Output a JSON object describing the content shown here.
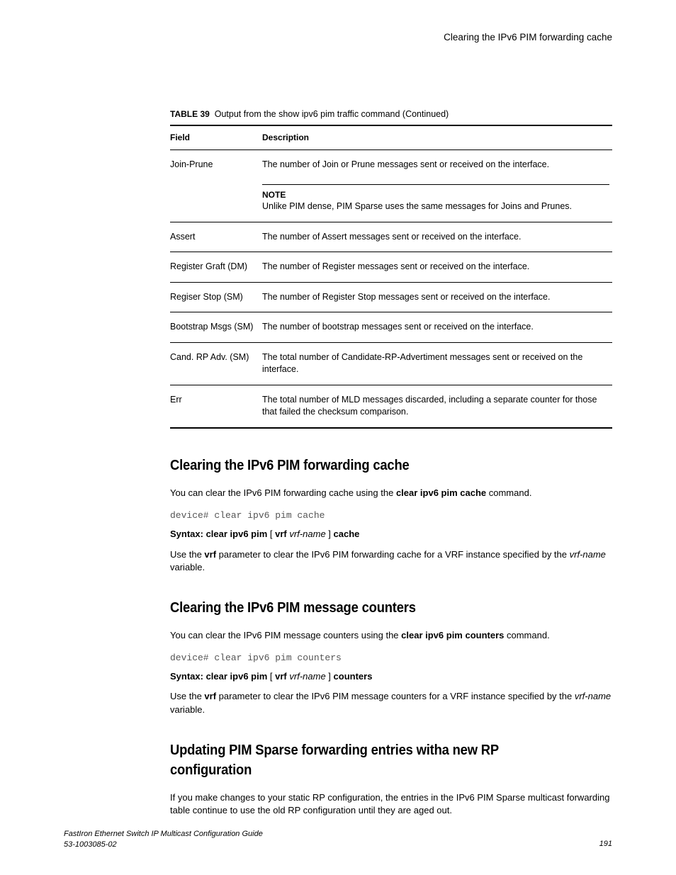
{
  "header": {
    "running_title": "Clearing the IPv6 PIM forwarding cache"
  },
  "table": {
    "caption_label": "TABLE 39",
    "caption_text": "Output from the show ipv6 pim traffic command (Continued)",
    "col_field": "Field",
    "col_desc": "Description",
    "rows": [
      {
        "field": "Join-Prune",
        "desc": "The number of Join or Prune messages sent or received on the interface.",
        "note_label": "NOTE",
        "note": "Unlike PIM dense, PIM Sparse uses the same messages for Joins and Prunes."
      },
      {
        "field": "Assert",
        "desc": "The number of Assert messages sent or received on the interface."
      },
      {
        "field": "Register Graft (DM)",
        "desc": "The number of Register messages sent or received on the interface."
      },
      {
        "field": "Regiser Stop (SM)",
        "desc": "The number of Register Stop messages sent or received on the interface."
      },
      {
        "field": "Bootstrap Msgs (SM)",
        "desc": "The number of bootstrap messages sent or received on the interface."
      },
      {
        "field": "Cand. RP Adv. (SM)",
        "desc": "The total number of Candidate-RP-Advertiment messages sent or received on the interface."
      },
      {
        "field": "Err",
        "desc": "The total number of MLD messages discarded, including a separate counter for those that failed the checksum comparison."
      }
    ]
  },
  "sections": {
    "s1": {
      "heading": "Clearing the IPv6 PIM forwarding cache",
      "p1_a": "You can clear the IPv6 PIM forwarding cache using the ",
      "p1_b": "clear ipv6 pim cache",
      "p1_c": " command.",
      "code": "device# clear ipv6 pim cache",
      "syn_label": "Syntax: ",
      "syn_b1": "clear ipv6 pim",
      "syn_br1": " [ ",
      "syn_b2": "vrf",
      "syn_sp": " ",
      "syn_i": "vrf-name",
      "syn_br2": " ] ",
      "syn_b3": "cache",
      "p2_a": "Use the ",
      "p2_b": "vrf",
      "p2_c": " parameter to clear the IPv6 PIM forwarding cache for a VRF instance specified by the ",
      "p2_d": "vrf-name",
      "p2_e": " variable."
    },
    "s2": {
      "heading": "Clearing the IPv6 PIM message counters",
      "p1_a": "You can clear the IPv6 PIM message counters using the ",
      "p1_b": "clear ipv6 pim counters",
      "p1_c": " command.",
      "code": "device# clear ipv6 pim counters",
      "syn_label": "Syntax: ",
      "syn_b1": "clear ipv6 pim",
      "syn_br1": " [ ",
      "syn_b2": "vrf",
      "syn_sp": " ",
      "syn_i": "vrf-name",
      "syn_br2": " ] ",
      "syn_b3": "counters",
      "p2_a": "Use the ",
      "p2_b": "vrf",
      "p2_c": " parameter to clear the IPv6 PIM message counters for a VRF instance specified by the ",
      "p2_d": "vrf-name",
      "p2_e": " variable."
    },
    "s3": {
      "heading": "Updating PIM Sparse forwarding entries witha new RP configuration",
      "p1": "If you make changes to your static RP configuration, the entries in the IPv6 PIM Sparse multicast forwarding table continue to use the old RP configuration until they are aged out."
    }
  },
  "footer": {
    "book": "FastIron Ethernet Switch IP Multicast Configuration Guide",
    "docnum": "53-1003085-02",
    "page": "191"
  }
}
